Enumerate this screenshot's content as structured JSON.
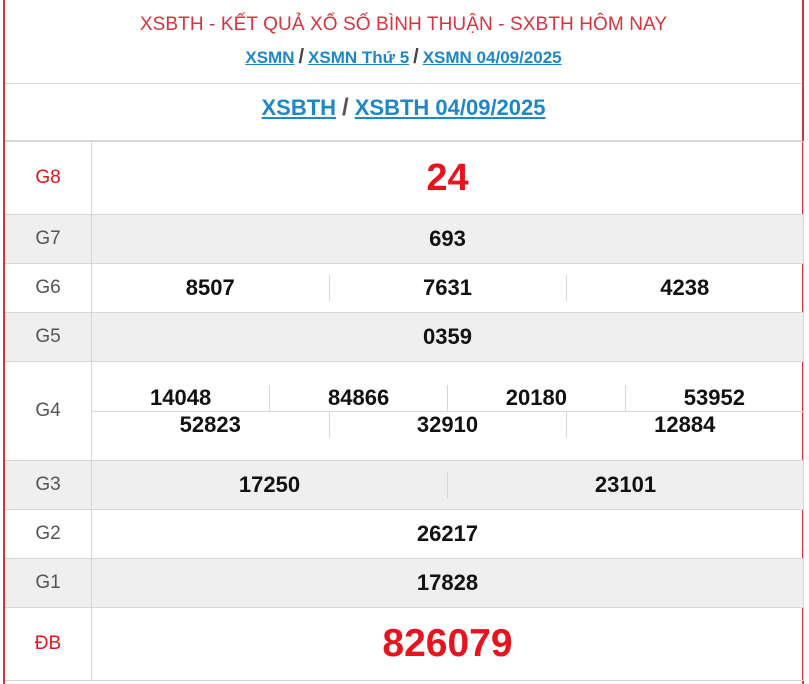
{
  "header": {
    "title": "XSBTH - KẾT QUẢ XỔ SỐ BÌNH THUẬN - SXBTH HÔM NAY",
    "links": [
      "XSMN",
      "XSMN Thứ 5",
      "XSMN 04/09/2025"
    ],
    "separator": "/"
  },
  "subheader": {
    "links": [
      "XSBTH",
      "XSBTH 04/09/2025"
    ],
    "separator": "/"
  },
  "colors": {
    "accent": "#d7333e",
    "link": "#1f87c8",
    "prize_red": "#e8141d"
  },
  "prizes": {
    "g8": {
      "label": "G8",
      "numbers": [
        "24"
      ]
    },
    "g7": {
      "label": "G7",
      "numbers": [
        "693"
      ]
    },
    "g6": {
      "label": "G6",
      "numbers": [
        "8507",
        "7631",
        "4238"
      ]
    },
    "g5": {
      "label": "G5",
      "numbers": [
        "0359"
      ]
    },
    "g4": {
      "label": "G4",
      "numbers": [
        "14048",
        "84866",
        "20180",
        "53952",
        "52823",
        "32910",
        "12884"
      ]
    },
    "g3": {
      "label": "G3",
      "numbers": [
        "17250",
        "23101"
      ]
    },
    "g2": {
      "label": "G2",
      "numbers": [
        "26217"
      ]
    },
    "g1": {
      "label": "G1",
      "numbers": [
        "17828"
      ]
    },
    "db": {
      "label": "ĐB",
      "numbers": [
        "826079"
      ]
    }
  }
}
